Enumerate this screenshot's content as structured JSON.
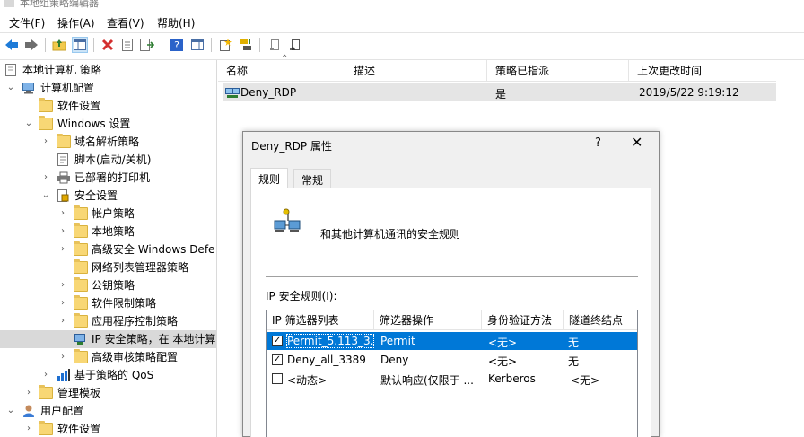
{
  "window": {
    "title": "本地组策略编辑器"
  },
  "menu": {
    "file": "文件(F)",
    "action": "操作(A)",
    "view": "查看(V)",
    "help": "帮助(H)"
  },
  "toolbar": {
    "icons": [
      "back-icon",
      "forward-icon",
      "up-folder-icon",
      "show-hide-tree-icon",
      "delete-icon",
      "properties-icon",
      "export-list-icon",
      "help-icon",
      "show-hide-action-pane-icon",
      "new-policy-icon",
      "assign-icon",
      "unassign-icon",
      "manage-filters-icon"
    ]
  },
  "tree": {
    "root": "本地计算机 策略",
    "computer_config": "计算机配置",
    "software_settings": "软件设置",
    "windows_settings": "Windows 设置",
    "dns_policy": "域名解析策略",
    "scripts": "脚本(启动/关机)",
    "printers": "已部署的打印机",
    "security_settings": "安全设置",
    "account_policies": "帐户策略",
    "local_policies": "本地策略",
    "wf_advanced": "高级安全 Windows Defe",
    "network_list": "网络列表管理器策略",
    "public_key": "公钥策略",
    "software_restriction": "软件限制策略",
    "app_control": "应用程序控制策略",
    "ipsec": "IP 安全策略，在 本地计算",
    "advanced_audit": "高级审核策略配置",
    "qos": "基于策略的 QoS",
    "admin_templates": "管理模板",
    "user_config": "用户配置",
    "user_software_settings": "软件设置"
  },
  "list": {
    "columns": {
      "name": "名称",
      "description": "描述",
      "assigned": "策略已指派",
      "modified": "上次更改时间"
    },
    "rows": [
      {
        "name": "Deny_RDP",
        "description": "",
        "assigned": "是",
        "modified": "2019/5/22 9:19:12"
      }
    ]
  },
  "dialog": {
    "title": "Deny_RDP 属性",
    "help_glyph": "?",
    "close_glyph": "✕",
    "tabs": {
      "rules": "规则",
      "general": "常规"
    },
    "description": "和其他计算机通讯的安全规则",
    "rules_label": "IP 安全规则(I):",
    "table": {
      "columns": {
        "filter_list": "IP 筛选器列表",
        "filter_action": "筛选器操作",
        "auth": "身份验证方法",
        "tunnel": "隧道终结点"
      },
      "rows": [
        {
          "checked": "✓",
          "filter_list": "Permit_5.113_3...",
          "filter_action": "Permit",
          "auth": "<无>",
          "tunnel": "无"
        },
        {
          "checked": "✓",
          "filter_list": "Deny_all_3389",
          "filter_action": "Deny",
          "auth": "<无>",
          "tunnel": "无"
        },
        {
          "checked": "",
          "filter_list": "<动态>",
          "filter_action": "默认响应(仅限于 ...",
          "auth": "Kerberos",
          "tunnel": "<无>"
        }
      ]
    }
  },
  "colors": {
    "selection": "#0078d7",
    "folder": "#f8d775",
    "tree_selected": "#d9d9d9"
  }
}
